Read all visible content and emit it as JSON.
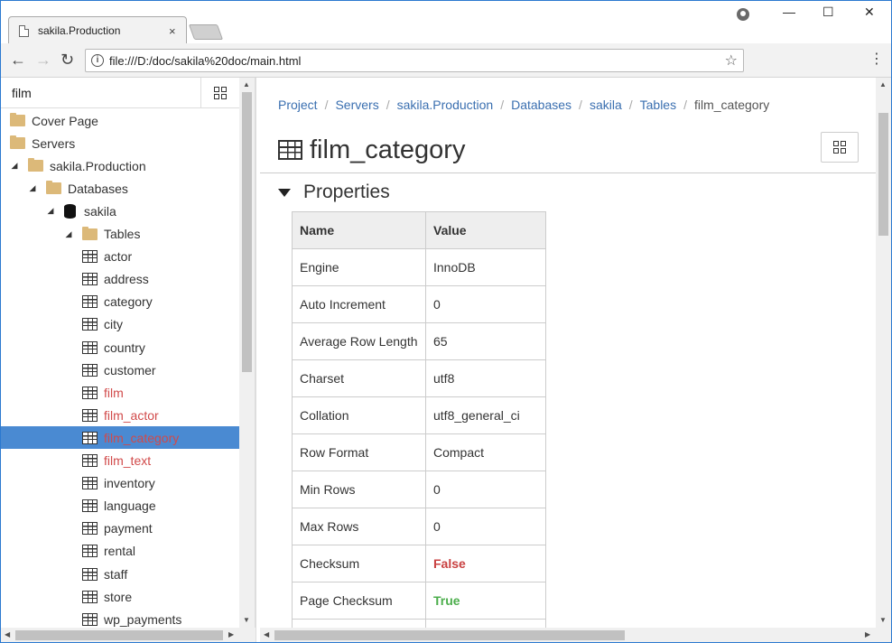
{
  "browser": {
    "tab_title": "sakila.Production",
    "tab_close": "×",
    "url": "file:///D:/doc/sakila%20doc/main.html",
    "back": "←",
    "forward": "→",
    "reload": "↻",
    "star": "☆",
    "menu": "⋮",
    "minimize": "—",
    "maximize": "☐",
    "close": "✕"
  },
  "sidebar": {
    "search_value": "film",
    "tree": [
      {
        "label": "Cover Page",
        "icon": "folder-icon",
        "level": 0,
        "expander": "",
        "highlight": false
      },
      {
        "label": "Servers",
        "icon": "folder-icon",
        "level": 0,
        "expander": "",
        "highlight": false
      },
      {
        "label": "sakila.Production",
        "icon": "folder-icon",
        "level": 0,
        "expander": "◢",
        "highlight": false
      },
      {
        "label": "Databases",
        "icon": "folder-icon",
        "level": 1,
        "expander": "◢",
        "highlight": false
      },
      {
        "label": "sakila",
        "icon": "database-icon",
        "level": 2,
        "expander": "◢",
        "highlight": false
      },
      {
        "label": "Tables",
        "icon": "folder-icon",
        "level": 3,
        "expander": "◢",
        "highlight": false
      },
      {
        "label": "actor",
        "icon": "table-icon",
        "level": 4,
        "expander": "",
        "highlight": false
      },
      {
        "label": "address",
        "icon": "table-icon",
        "level": 4,
        "expander": "",
        "highlight": false
      },
      {
        "label": "category",
        "icon": "table-icon",
        "level": 4,
        "expander": "",
        "highlight": false
      },
      {
        "label": "city",
        "icon": "table-icon",
        "level": 4,
        "expander": "",
        "highlight": false
      },
      {
        "label": "country",
        "icon": "table-icon",
        "level": 4,
        "expander": "",
        "highlight": false
      },
      {
        "label": "customer",
        "icon": "table-icon",
        "level": 4,
        "expander": "",
        "highlight": false
      },
      {
        "label": "film",
        "icon": "table-icon",
        "level": 4,
        "expander": "",
        "highlight": true
      },
      {
        "label": "film_actor",
        "icon": "table-icon",
        "level": 4,
        "expander": "",
        "highlight": true
      },
      {
        "label": "film_category",
        "icon": "table-icon",
        "level": 4,
        "expander": "",
        "highlight": true,
        "selected": true
      },
      {
        "label": "film_text",
        "icon": "table-icon",
        "level": 4,
        "expander": "",
        "highlight": true
      },
      {
        "label": "inventory",
        "icon": "table-icon",
        "level": 4,
        "expander": "",
        "highlight": false
      },
      {
        "label": "language",
        "icon": "table-icon",
        "level": 4,
        "expander": "",
        "highlight": false
      },
      {
        "label": "payment",
        "icon": "table-icon",
        "level": 4,
        "expander": "",
        "highlight": false
      },
      {
        "label": "rental",
        "icon": "table-icon",
        "level": 4,
        "expander": "",
        "highlight": false
      },
      {
        "label": "staff",
        "icon": "table-icon",
        "level": 4,
        "expander": "",
        "highlight": false
      },
      {
        "label": "store",
        "icon": "table-icon",
        "level": 4,
        "expander": "",
        "highlight": false
      },
      {
        "label": "wp_payments",
        "icon": "table-icon",
        "level": 4,
        "expander": "",
        "highlight": false
      }
    ]
  },
  "main": {
    "breadcrumb": [
      "Project",
      "Servers",
      "sakila.Production",
      "Databases",
      "sakila",
      "Tables"
    ],
    "breadcrumb_current": "film_category",
    "breadcrumb_sep": "/",
    "title": "film_category",
    "section_title": "Properties",
    "properties": {
      "header_name": "Name",
      "header_value": "Value",
      "rows": [
        {
          "name": "Engine",
          "value": "InnoDB",
          "style": ""
        },
        {
          "name": "Auto Increment",
          "value": "0",
          "style": ""
        },
        {
          "name": "Average Row Length",
          "value": "65",
          "style": ""
        },
        {
          "name": "Charset",
          "value": "utf8",
          "style": ""
        },
        {
          "name": "Collation",
          "value": "utf8_general_ci",
          "style": ""
        },
        {
          "name": "Row Format",
          "value": "Compact",
          "style": ""
        },
        {
          "name": "Min Rows",
          "value": "0",
          "style": ""
        },
        {
          "name": "Max Rows",
          "value": "0",
          "style": ""
        },
        {
          "name": "Checksum",
          "value": "False",
          "style": "false"
        },
        {
          "name": "Page Checksum",
          "value": "True",
          "style": "true"
        },
        {
          "name": "",
          "value": "",
          "style": ""
        }
      ]
    }
  },
  "colors": {
    "accent": "#4a8ad2",
    "link": "#3a6fb0",
    "highlight_text": "#d14a4a",
    "false": "#c94141",
    "true": "#4cae4c"
  }
}
